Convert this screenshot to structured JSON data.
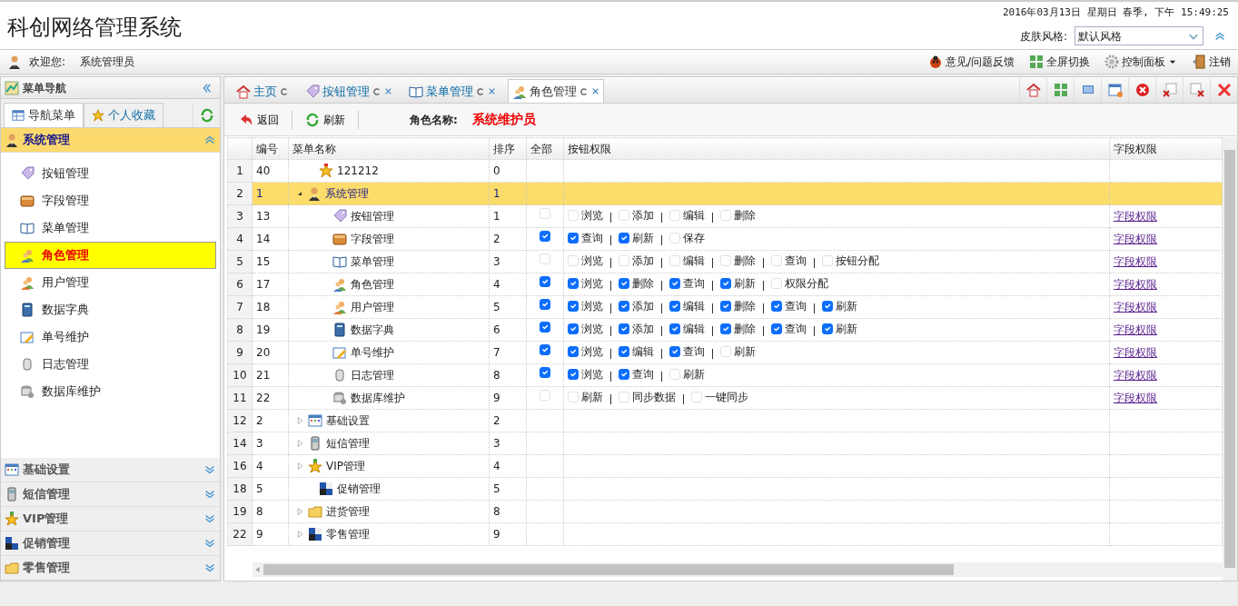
{
  "header": {
    "title": "科创网络管理系统",
    "datetime": "2016年03月13日 星期日 春季, 下午 15:49:25",
    "skin_label": "皮肤风格:",
    "skin_value": "默认风格"
  },
  "user_bar": {
    "welcome_label": "欢迎您:",
    "user_name": "系统管理员",
    "actions": [
      {
        "label": "意见/问题反馈",
        "dropdown": false
      },
      {
        "label": "全屏切换",
        "dropdown": false
      },
      {
        "label": "控制面板",
        "dropdown": true
      },
      {
        "label": "注销",
        "dropdown": false
      }
    ]
  },
  "sidebar": {
    "title": "菜单导航",
    "tabs": [
      {
        "label": "导航菜单",
        "selected": true
      },
      {
        "label": "个人收藏",
        "selected": false
      }
    ],
    "groups": [
      {
        "label": "系统管理",
        "expanded": true,
        "items": [
          {
            "label": "按钮管理",
            "selected": false
          },
          {
            "label": "字段管理",
            "selected": false
          },
          {
            "label": "菜单管理",
            "selected": false
          },
          {
            "label": "角色管理",
            "selected": true
          },
          {
            "label": "用户管理",
            "selected": false
          },
          {
            "label": "数据字典",
            "selected": false
          },
          {
            "label": "单号维护",
            "selected": false
          },
          {
            "label": "日志管理",
            "selected": false
          },
          {
            "label": "数据库维护",
            "selected": false
          }
        ]
      },
      {
        "label": "基础设置",
        "expanded": false
      },
      {
        "label": "短信管理",
        "expanded": false
      },
      {
        "label": "VIP管理",
        "expanded": false
      },
      {
        "label": "促销管理",
        "expanded": false
      },
      {
        "label": "零售管理",
        "expanded": false
      }
    ]
  },
  "tabs": [
    {
      "label": "主页",
      "selected": false,
      "closable": false
    },
    {
      "label": "按钮管理",
      "selected": false,
      "closable": true
    },
    {
      "label": "菜单管理",
      "selected": false,
      "closable": true
    },
    {
      "label": "角色管理",
      "selected": true,
      "closable": true
    }
  ],
  "toolbar": {
    "buttons": [
      "返回",
      "刷新"
    ],
    "role_label": "角色名称:",
    "role_value": "系统维护员"
  },
  "table": {
    "columns": [
      "编号",
      "菜单名称",
      "排序",
      "全部",
      "按钮权限",
      "字段权限"
    ],
    "rows": [
      {
        "row_number": "1",
        "id": "40",
        "name": "121212",
        "sort": "0",
        "selected": false
      },
      {
        "row_number": "2",
        "id": "1",
        "name": "系统管理",
        "sort": "1",
        "selected": true,
        "expanded": true,
        "children": [
          {
            "row_number": "3",
            "id": "13",
            "name": "按钮管理",
            "sort": "1",
            "selected": false,
            "all_checked": false,
            "permissions": [
              {
                "label": "浏览",
                "checked": false
              },
              {
                "label": "添加",
                "checked": false
              },
              {
                "label": "编辑",
                "checked": false
              },
              {
                "label": "删除",
                "checked": false
              }
            ],
            "field_link": "字段权限"
          },
          {
            "row_number": "4",
            "id": "14",
            "name": "字段管理",
            "sort": "2",
            "selected": false,
            "all_checked": true,
            "permissions": [
              {
                "label": "查询",
                "checked": true
              },
              {
                "label": "刷新",
                "checked": true
              },
              {
                "label": "保存",
                "checked": false
              }
            ],
            "field_link": "字段权限"
          },
          {
            "row_number": "5",
            "id": "15",
            "name": "菜单管理",
            "sort": "3",
            "selected": false,
            "all_checked": false,
            "permissions": [
              {
                "label": "浏览",
                "checked": false
              },
              {
                "label": "添加",
                "checked": false
              },
              {
                "label": "编辑",
                "checked": false
              },
              {
                "label": "删除",
                "checked": false
              },
              {
                "label": "查询",
                "checked": false
              },
              {
                "label": "按钮分配",
                "checked": false
              }
            ],
            "field_link": "字段权限"
          },
          {
            "row_number": "6",
            "id": "17",
            "name": "角色管理",
            "sort": "4",
            "selected": false,
            "all_checked": true,
            "permissions": [
              {
                "label": "浏览",
                "checked": true
              },
              {
                "label": "删除",
                "checked": true
              },
              {
                "label": "查询",
                "checked": true
              },
              {
                "label": "刷新",
                "checked": true
              },
              {
                "label": "权限分配",
                "checked": false
              }
            ],
            "field_link": "字段权限"
          },
          {
            "row_number": "7",
            "id": "18",
            "name": "用户管理",
            "sort": "5",
            "selected": false,
            "all_checked": true,
            "permissions": [
              {
                "label": "浏览",
                "checked": true
              },
              {
                "label": "添加",
                "checked": true
              },
              {
                "label": "编辑",
                "checked": true
              },
              {
                "label": "删除",
                "checked": true
              },
              {
                "label": "查询",
                "checked": true
              },
              {
                "label": "刷新",
                "checked": true
              }
            ],
            "field_link": "字段权限"
          },
          {
            "row_number": "8",
            "id": "19",
            "name": "数据字典",
            "sort": "6",
            "selected": false,
            "all_checked": true,
            "permissions": [
              {
                "label": "浏览",
                "checked": true
              },
              {
                "label": "添加",
                "checked": true
              },
              {
                "label": "编辑",
                "checked": true
              },
              {
                "label": "删除",
                "checked": true
              },
              {
                "label": "查询",
                "checked": true
              },
              {
                "label": "刷新",
                "checked": true
              }
            ],
            "field_link": "字段权限"
          },
          {
            "row_number": "9",
            "id": "20",
            "name": "单号维护",
            "sort": "7",
            "selected": false,
            "all_checked": true,
            "permissions": [
              {
                "label": "浏览",
                "checked": true
              },
              {
                "label": "编辑",
                "checked": true
              },
              {
                "label": "查询",
                "checked": true
              },
              {
                "label": "刷新",
                "checked": false
              }
            ],
            "field_link": "字段权限"
          },
          {
            "row_number": "10",
            "id": "21",
            "name": "日志管理",
            "sort": "8",
            "selected": false,
            "all_checked": true,
            "permissions": [
              {
                "label": "浏览",
                "checked": true
              },
              {
                "label": "查询",
                "checked": true
              },
              {
                "label": "刷新",
                "checked": false
              }
            ],
            "field_link": "字段权限"
          },
          {
            "row_number": "11",
            "id": "22",
            "name": "数据库维护",
            "sort": "9",
            "selected": false,
            "all_checked": false,
            "permissions": [
              {
                "label": "刷新",
                "checked": false
              },
              {
                "label": "同步数据",
                "checked": false
              },
              {
                "label": "一键同步",
                "checked": false
              }
            ],
            "field_link": "字段权限"
          }
        ]
      },
      {
        "row_number": "12",
        "id": "2",
        "name": "基础设置",
        "sort": "2",
        "selected": false,
        "expanded": false
      },
      {
        "row_number": "14",
        "id": "3",
        "name": "短信管理",
        "sort": "3",
        "selected": false,
        "expanded": false
      },
      {
        "row_number": "16",
        "id": "4",
        "name": "VIP管理",
        "sort": "4",
        "selected": false,
        "expanded": false
      },
      {
        "row_number": "18",
        "id": "5",
        "name": "促销管理",
        "sort": "5",
        "selected": false
      },
      {
        "row_number": "19",
        "id": "8",
        "name": "进货管理",
        "sort": "8",
        "selected": false,
        "expanded": false
      },
      {
        "row_number": "22",
        "id": "9",
        "name": "零售管理",
        "sort": "9",
        "selected": false,
        "expanded": false
      }
    ]
  }
}
